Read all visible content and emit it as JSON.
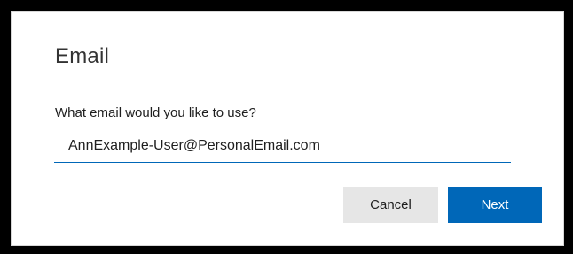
{
  "dialog": {
    "title": "Email",
    "prompt": "What email would you like to use?",
    "email_value": "AnnExample-User@PersonalEmail.com",
    "cancel_label": "Cancel",
    "next_label": "Next"
  },
  "colors": {
    "accent": "#0067b8",
    "frame": "#000000",
    "cancel_bg": "#e6e6e6"
  }
}
